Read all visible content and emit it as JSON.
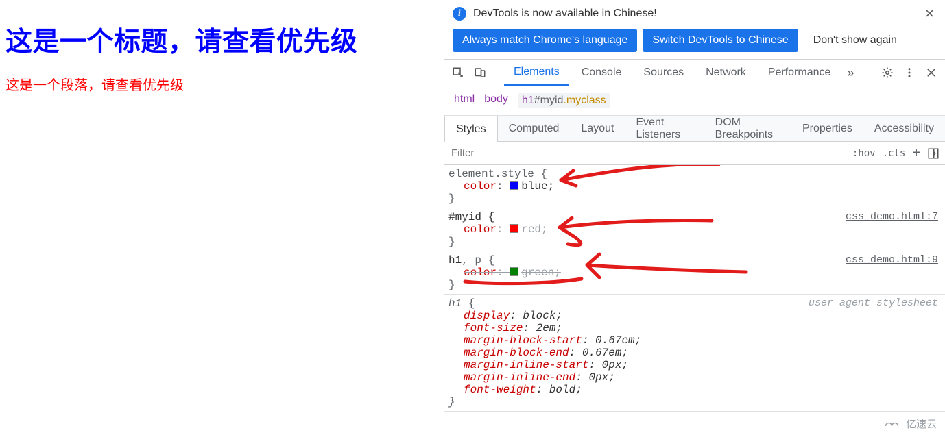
{
  "page": {
    "h1": "这是一个标题，请查看优先级",
    "p": "这是一个段落，请查看优先级"
  },
  "notice": {
    "text": "DevTools is now available in Chinese!",
    "btn_always": "Always match Chrome's language",
    "btn_switch": "Switch DevTools to Chinese",
    "btn_dismiss": "Don't show again"
  },
  "tabs": {
    "elements": "Elements",
    "console": "Console",
    "sources": "Sources",
    "network": "Network",
    "performance": "Performance"
  },
  "crumbs": {
    "html": "html",
    "body": "body",
    "sel_tag": "h1",
    "sel_id": "#myid",
    "sel_cls": ".myclass"
  },
  "subtabs": {
    "styles": "Styles",
    "computed": "Computed",
    "layout": "Layout",
    "listeners": "Event Listeners",
    "dombp": "DOM Breakpoints",
    "props": "Properties",
    "a11y": "Accessibility"
  },
  "filter": {
    "placeholder": "Filter",
    "hov": ":hov",
    "cls": ".cls"
  },
  "rules": [
    {
      "selector": "element.style",
      "source": "",
      "decls": [
        {
          "prop": "color",
          "value": "blue",
          "swatch": "#0000ff",
          "overridden": false
        }
      ]
    },
    {
      "selector": "#myid",
      "source": "css_demo.html:7",
      "decls": [
        {
          "prop": "color",
          "value": "red",
          "swatch": "#ff0000",
          "overridden": true
        }
      ]
    },
    {
      "selector_strong": "h1",
      "selector_rest": ", p",
      "source": "css_demo.html:9",
      "decls": [
        {
          "prop": "color",
          "value": "green",
          "swatch": "#008000",
          "overridden": true
        }
      ]
    },
    {
      "selector_ital": "h1",
      "ua_note": "user agent stylesheet",
      "ua": true,
      "decls": [
        {
          "prop": "display",
          "value": "block"
        },
        {
          "prop": "font-size",
          "value": "2em"
        },
        {
          "prop": "margin-block-start",
          "value": "0.67em"
        },
        {
          "prop": "margin-block-end",
          "value": "0.67em"
        },
        {
          "prop": "margin-inline-start",
          "value": "0px"
        },
        {
          "prop": "margin-inline-end",
          "value": "0px"
        },
        {
          "prop": "font-weight",
          "value": "bold"
        }
      ]
    }
  ],
  "watermark": "亿速云"
}
